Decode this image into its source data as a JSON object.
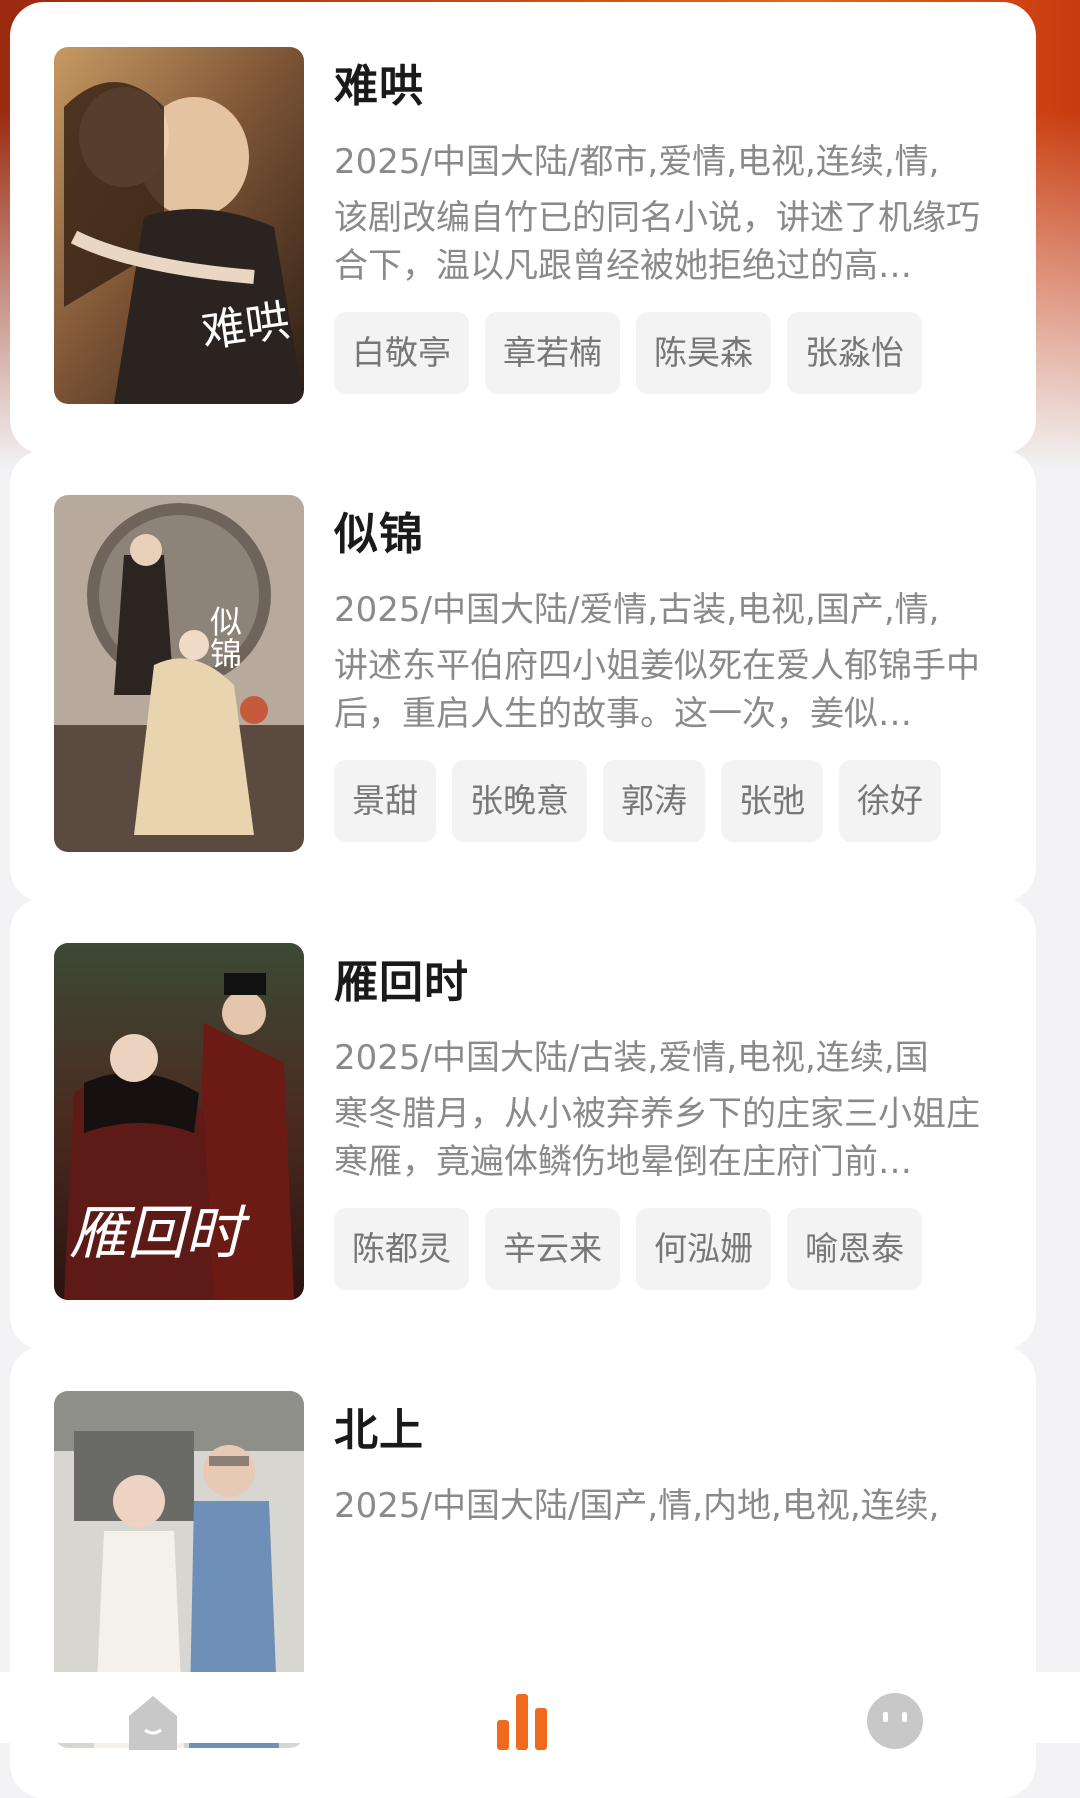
{
  "shows": [
    {
      "title": "难哄",
      "meta": "2025/中国大陆/都市,爱情,电视,连续,情,",
      "description": "该剧改编自竹已的同名小说，讲述了机缘巧合下，温以凡跟曾经被她拒绝过的高…",
      "cast": [
        "白敬亭",
        "章若楠",
        "陈昊森",
        "张淼怡"
      ],
      "poster_calligraphy": "难哄",
      "poster_colors": [
        "#3a2a1c",
        "#b98a5a",
        "#6b4a30"
      ]
    },
    {
      "title": "似锦",
      "meta": "2025/中国大陆/爱情,古装,电视,国产,情,",
      "description": "讲述东平伯府四小姐姜似死在爱人郁锦手中后，重启人生的故事。这一次，姜似…",
      "cast": [
        "景甜",
        "张晚意",
        "郭涛",
        "张弛",
        "徐好"
      ],
      "poster_calligraphy": "似锦",
      "poster_colors": [
        "#8b7d70",
        "#d9cbb8",
        "#4a3e36"
      ]
    },
    {
      "title": "雁回时",
      "meta": "2025/中国大陆/古装,爱情,电视,连续,国",
      "description": "寒冬腊月，从小被弃养乡下的庄家三小姐庄寒雁，竟遍体鳞伤地晕倒在庄府门前…",
      "cast": [
        "陈都灵",
        "辛云来",
        "何泓姗",
        "喻恩泰"
      ],
      "poster_calligraphy": "雁回时",
      "poster_colors": [
        "#2a1a16",
        "#7a2018",
        "#3c4a3a"
      ]
    },
    {
      "title": "北上",
      "meta": "2025/中国大陆/国产,情,内地,电视,连续,",
      "description": "",
      "cast": [],
      "poster_calligraphy": "",
      "poster_colors": [
        "#c9c9c4",
        "#f2efe8",
        "#5a5a58"
      ]
    }
  ],
  "tabbar": {
    "items": [
      {
        "icon": "home-icon",
        "active": false
      },
      {
        "icon": "ranking-bars-icon",
        "active": true
      },
      {
        "icon": "profile-face-icon",
        "active": false
      }
    ],
    "active_color": "#f06a1e",
    "inactive_color": "#c8c8c8"
  }
}
